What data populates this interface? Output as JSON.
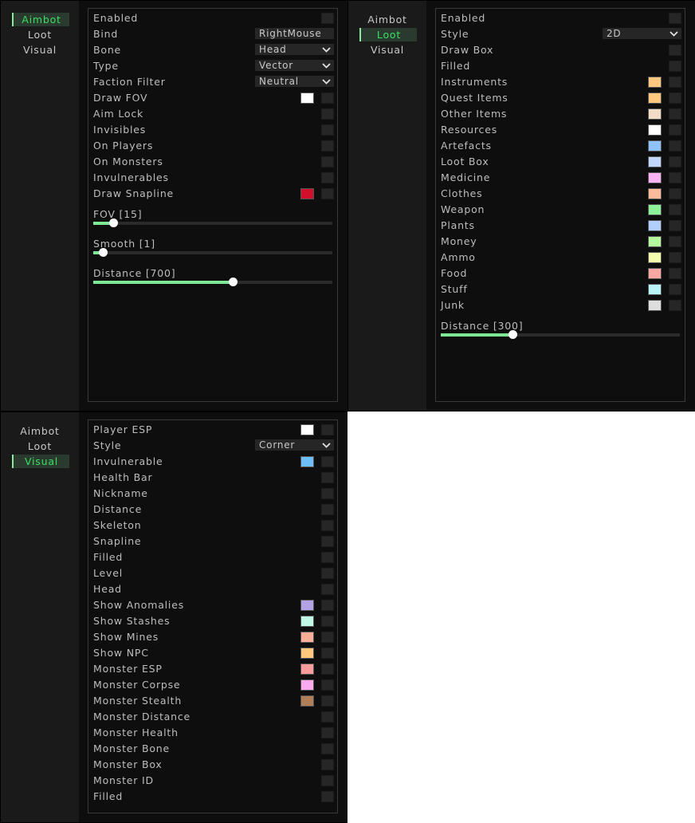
{
  "tabs": [
    "Aimbot",
    "Loot",
    "Visual"
  ],
  "windows": [
    {
      "active_tab": 0,
      "rows": [
        {
          "label": "Enabled",
          "kind": "check"
        },
        {
          "label": "Bind",
          "kind": "field",
          "value": "RightMouse"
        },
        {
          "label": "Bone",
          "kind": "dropdown",
          "value": "Head"
        },
        {
          "label": "Type",
          "kind": "dropdown",
          "value": "Vector"
        },
        {
          "label": "Faction Filter",
          "kind": "dropdown",
          "value": "Neutral"
        },
        {
          "label": "Draw FOV",
          "kind": "check",
          "color": "#ffffff"
        },
        {
          "label": "Aim Lock",
          "kind": "check"
        },
        {
          "label": "Invisibles",
          "kind": "check"
        },
        {
          "label": "On Players",
          "kind": "check"
        },
        {
          "label": "On Monsters",
          "kind": "check"
        },
        {
          "label": "Invulnerables",
          "kind": "check"
        },
        {
          "label": "Draw Snapline",
          "kind": "check",
          "color": "#d0102a"
        }
      ],
      "sliders": [
        {
          "label": "FOV [15]",
          "fraction": 0.083
        },
        {
          "label": "Smooth [1]",
          "fraction": 0.04
        },
        {
          "label": "Distance [700]",
          "fraction": 0.583
        }
      ]
    },
    {
      "active_tab": 1,
      "rows": [
        {
          "label": "Enabled",
          "kind": "check"
        },
        {
          "label": "Style",
          "kind": "dropdown",
          "value": "2D"
        },
        {
          "label": "Draw Box",
          "kind": "check"
        },
        {
          "label": "Filled",
          "kind": "check"
        },
        {
          "label": "Instruments",
          "kind": "check",
          "color": "#ffc87e"
        },
        {
          "label": "Quest Items",
          "kind": "check",
          "color": "#ffc87e"
        },
        {
          "label": "Other Items",
          "kind": "check",
          "color": "#f2dcc8"
        },
        {
          "label": "Resources",
          "kind": "check",
          "color": "#ffffff"
        },
        {
          "label": "Artefacts",
          "kind": "check",
          "color": "#8ec2f8"
        },
        {
          "label": "Loot Box",
          "kind": "check",
          "color": "#c2d6fa"
        },
        {
          "label": "Medicine",
          "kind": "check",
          "color": "#fab2f2"
        },
        {
          "label": "Clothes",
          "kind": "check",
          "color": "#fcbc9c"
        },
        {
          "label": "Weapon",
          "kind": "check",
          "color": "#8ef29a"
        },
        {
          "label": "Plants",
          "kind": "check",
          "color": "#b2cefa"
        },
        {
          "label": "Money",
          "kind": "check",
          "color": "#b6f89e"
        },
        {
          "label": "Ammo",
          "kind": "check",
          "color": "#f6fcae"
        },
        {
          "label": "Food",
          "kind": "check",
          "color": "#fca8a2"
        },
        {
          "label": "Stuff",
          "kind": "check",
          "color": "#b8f4f8"
        },
        {
          "label": "Junk",
          "kind": "check",
          "color": "#dedede"
        }
      ],
      "sliders": [
        {
          "label": "Distance [300]",
          "fraction": 0.3
        }
      ]
    },
    {
      "active_tab": 2,
      "rows": [
        {
          "label": "Player ESP",
          "kind": "check",
          "color": "#ffffff"
        },
        {
          "label": "Style",
          "kind": "dropdown",
          "value": "Corner"
        },
        {
          "label": "Invulnerable",
          "kind": "check",
          "color": "#6ebef8"
        },
        {
          "label": "Health Bar",
          "kind": "check"
        },
        {
          "label": "Nickname",
          "kind": "check"
        },
        {
          "label": "Distance",
          "kind": "check"
        },
        {
          "label": "Skeleton",
          "kind": "check"
        },
        {
          "label": "Snapline",
          "kind": "check"
        },
        {
          "label": "Filled",
          "kind": "check"
        },
        {
          "label": "Level",
          "kind": "check"
        },
        {
          "label": "Head",
          "kind": "check"
        },
        {
          "label": "Show Anomalies",
          "kind": "check",
          "color": "#b4a2e6"
        },
        {
          "label": "Show Stashes",
          "kind": "check",
          "color": "#c2f8e6"
        },
        {
          "label": "Show Mines",
          "kind": "check",
          "color": "#fcae98"
        },
        {
          "label": "Show NPC",
          "kind": "check",
          "color": "#ffc87e"
        },
        {
          "label": "Monster ESP",
          "kind": "check",
          "color": "#fc9c9c"
        },
        {
          "label": "Monster Corpse",
          "kind": "check",
          "color": "#fcaaf0"
        },
        {
          "label": "Monster Stealth",
          "kind": "check",
          "color": "#b07e58"
        },
        {
          "label": "Monster Distance",
          "kind": "check"
        },
        {
          "label": "Monster Health",
          "kind": "check"
        },
        {
          "label": "Monster Bone",
          "kind": "check"
        },
        {
          "label": "Monster Box",
          "kind": "check"
        },
        {
          "label": "Monster ID",
          "kind": "check"
        },
        {
          "label": "Filled",
          "kind": "check"
        }
      ],
      "sliders": []
    }
  ]
}
